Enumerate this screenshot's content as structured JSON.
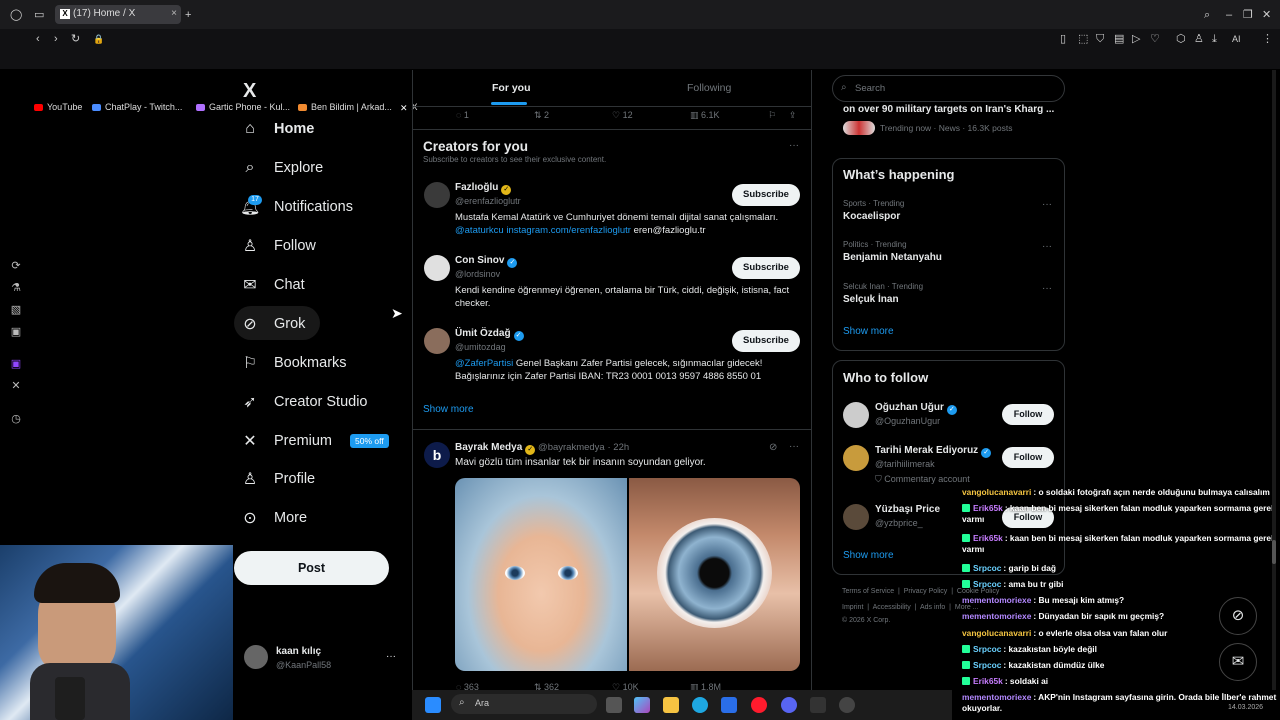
{
  "browser": {
    "tab_title": "(17) Home / X",
    "url": "x.com/home",
    "bookmarks": [
      "YouTube",
      "ChatPlay - Twitch...",
      "Gartic Phone - Kul...",
      "Ben Bildim | Arkad...",
      "X"
    ]
  },
  "nav": {
    "logo": "X",
    "items": [
      "Home",
      "Explore",
      "Notifications",
      "Follow",
      "Chat",
      "Grok",
      "Bookmarks",
      "Creator Studio",
      "Premium",
      "Profile",
      "More"
    ],
    "notif_count": "17",
    "premium_badge": "50% off",
    "post_label": "Post",
    "user_name": "kaan kılıç",
    "user_handle": "@KaanPall58"
  },
  "feed": {
    "tabs": [
      "For you",
      "Following"
    ],
    "top_actions": {
      "replies": "1",
      "reposts": "2",
      "likes": "12",
      "views": "6.1K"
    },
    "creators": {
      "title": "Creators for you",
      "subtitle": "Subscribe to creators to see their exclusive content.",
      "items": [
        {
          "name": "Fazlıoğlu",
          "handle": "@erenfazlioglutr",
          "bio": "Mustafa Kemal Atatürk ve Cumhuriyet dönemi temalı dijital sanat çalışmaları.",
          "bio_links": "@ataturkcu instagram.com/erenfazlioglutr",
          "bio_tail": "eren@fazlioglu.tr",
          "button": "Subscribe"
        },
        {
          "name": "Con Sinov",
          "handle": "@lordsinov",
          "bio": "Kendi kendine öğrenmeyi öğrenen, ortalama bir Türk, ciddi, değişik, istisna, fact checker.",
          "button": "Subscribe"
        },
        {
          "name": "Ümit Özdağ",
          "handle": "@umitozdag",
          "bio_link": "@ZaferPartisi",
          "bio": "Genel Başkanı Zafer Partisi gelecek, sığınmacılar gidecek! Bağışlarınız için Zafer Partisi IBAN: TR23 0001 0013 9597 4886 8550 01",
          "button": "Subscribe"
        }
      ],
      "show_more": "Show more"
    },
    "post": {
      "name": "Bayrak Medya",
      "handle": "@bayrakmedya",
      "time": "· 22h",
      "text": "Mavi gözlü tüm insanlar tek bir insanın soyundan geliyor.",
      "stats": {
        "replies": "363",
        "reposts": "362",
        "likes": "10K",
        "views": "1.8M"
      }
    }
  },
  "right": {
    "search_placeholder": "Search",
    "top_news": {
      "title": "on over 90 military targets on Iran's Kharg ...",
      "meta": "Trending now · News · 16.3K posts"
    },
    "happening": {
      "title": "What’s happening",
      "trends": [
        {
          "meta": "Sports · Trending",
          "name": "Kocaelispor"
        },
        {
          "meta": "Politics · Trending",
          "name": "Benjamin Netanyahu"
        },
        {
          "meta": "Selcuk Inan · Trending",
          "name": "Selçuk İnan"
        }
      ],
      "show_more": "Show more"
    },
    "who_to_follow": {
      "title": "Who to follow",
      "items": [
        {
          "name": "Oğuzhan Uğur",
          "handle": "@OguzhanUgur",
          "button": "Follow"
        },
        {
          "name": "Tarihi Merak Ediyoruz",
          "handle": "@tarihiilimerak",
          "note": "Commentary account",
          "button": "Follow"
        },
        {
          "name": "Yüzbaşı Price",
          "handle": "@yzbprice_",
          "button": "Follow"
        }
      ],
      "show_more": "Show more"
    },
    "footer": [
      "Terms of Service",
      "Privacy Policy",
      "Cookie Policy",
      "Imprint",
      "Accessibility",
      "Ads info",
      "More ...",
      "© 2026 X Corp."
    ]
  },
  "chat": [
    {
      "user": "vangolucanavarri",
      "msg": ": o soldaki fotoğrafı açın nerde olduğunu bulmaya calısalım",
      "color": "#f5c542"
    },
    {
      "user": "Erik65k",
      "msg": ": kaan ben bi mesaj sikerken falan modluk yaparken sormama gerek varmı",
      "color": "#c77dff"
    },
    {
      "user": "Erik65k",
      "msg": ": kaan ben bi mesaj sikerken falan modluk yaparken sormama gerek varmı",
      "color": "#c77dff"
    },
    {
      "user": "Srpcoc",
      "msg": ": garip bi dağ",
      "color": "#6ad1ff"
    },
    {
      "user": "Srpcoc",
      "msg": ": ama bu tr gibi",
      "color": "#6ad1ff"
    },
    {
      "user": "mementomoriexe",
      "msg": ": Bu mesajı kim atmış?",
      "color": "#b388ff"
    },
    {
      "user": "mementomoriexe",
      "msg": ": Dünyadan bir sapık mı geçmiş?",
      "color": "#b388ff"
    },
    {
      "user": "vangolucanavarri",
      "msg": ": o evlerle olsa olsa van falan olur",
      "color": "#f5c542"
    },
    {
      "user": "Srpcoc",
      "msg": ": kazakıstan böyle değil",
      "color": "#6ad1ff"
    },
    {
      "user": "Srpcoc",
      "msg": ": kazakistan dümdüz ülke",
      "color": "#6ad1ff"
    },
    {
      "user": "Erik65k",
      "msg": ": soldaki ai",
      "color": "#c77dff"
    },
    {
      "user": "mementomoriexe",
      "msg": ": AKP'nin Instagram sayfasına girin. Orada bile İlber'e rahmet okuyorlar.",
      "color": "#b388ff"
    }
  ],
  "taskbar": {
    "search_placeholder": "Ara",
    "date": "14.03.2026"
  }
}
